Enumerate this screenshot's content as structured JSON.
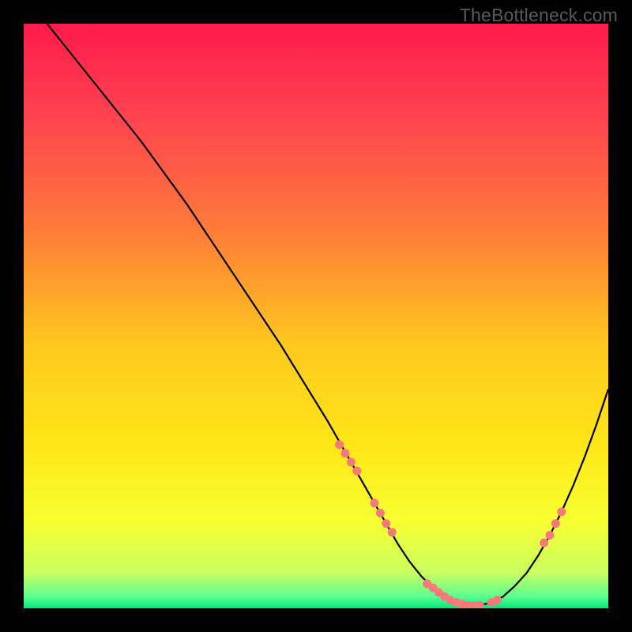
{
  "watermark": "TheBottleneck.com",
  "chart_data": {
    "type": "line",
    "title": "",
    "xlabel": "",
    "ylabel": "",
    "xlim": [
      0,
      100
    ],
    "ylim": [
      0,
      100
    ],
    "background_gradient": {
      "stops": [
        {
          "offset": 0,
          "color": "#ff1a4a"
        },
        {
          "offset": 0.15,
          "color": "#ff4050"
        },
        {
          "offset": 0.35,
          "color": "#ff7a3a"
        },
        {
          "offset": 0.55,
          "color": "#ffc81e"
        },
        {
          "offset": 0.72,
          "color": "#ffe617"
        },
        {
          "offset": 0.85,
          "color": "#f8ff30"
        },
        {
          "offset": 0.94,
          "color": "#c8ff60"
        },
        {
          "offset": 0.98,
          "color": "#5aff90"
        },
        {
          "offset": 1.0,
          "color": "#00e878"
        }
      ]
    },
    "series": [
      {
        "name": "bottleneck-curve",
        "type": "line",
        "color": "#000000",
        "x": [
          4,
          8,
          12,
          16,
          20,
          24,
          28,
          32,
          36,
          40,
          44,
          48,
          52,
          56,
          60,
          62,
          64,
          66,
          68,
          70,
          72,
          74,
          76,
          78,
          80,
          82,
          84,
          86,
          88,
          90,
          92,
          94,
          96,
          98,
          100
        ],
        "y": [
          100,
          95,
          90,
          85,
          80,
          74.5,
          69,
          63,
          57,
          51,
          45,
          38.5,
          32,
          25,
          18,
          14.5,
          11,
          8,
          5.5,
          3.5,
          2,
          1,
          0.5,
          0.5,
          1,
          2,
          3.8,
          6,
          9,
          12.5,
          16.5,
          21,
          26,
          31.5,
          37.5
        ]
      },
      {
        "name": "highlight-points",
        "type": "scatter",
        "color": "#f77a7a",
        "x": [
          54,
          55,
          56,
          57,
          60,
          61,
          62,
          63,
          69,
          70,
          71,
          72,
          73,
          74,
          75,
          76,
          77,
          78,
          80,
          81,
          89,
          90,
          91,
          92
        ],
        "y": [
          28,
          26.5,
          25,
          23.5,
          18,
          16.3,
          14.5,
          13,
          4.2,
          3.5,
          2.7,
          2,
          1.4,
          1,
          0.7,
          0.5,
          0.45,
          0.5,
          1,
          1.4,
          11.2,
          12.5,
          14.5,
          16.5
        ]
      }
    ]
  }
}
